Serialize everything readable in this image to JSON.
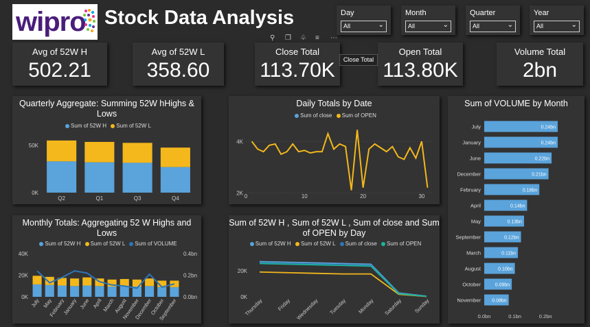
{
  "header": {
    "title": "Stock Data Analysis",
    "logo_text": "wipro"
  },
  "slicers": [
    {
      "label": "Day",
      "value": "All"
    },
    {
      "label": "Month",
      "value": "All"
    },
    {
      "label": "Quarter",
      "value": "All"
    },
    {
      "label": "Year",
      "value": "All"
    }
  ],
  "kpis": [
    {
      "label": "Avg of 52W H",
      "value": "502.21"
    },
    {
      "label": "Avg of 52W L",
      "value": "358.60"
    },
    {
      "label": "Close Total",
      "value": "113.70K"
    },
    {
      "label": "Open Total",
      "value": "113.80K"
    },
    {
      "label": "Volume Total",
      "value": "2bn"
    }
  ],
  "tooltip": "Close Total",
  "colors": {
    "blue": "#5aa3db",
    "yellow": "#f4b81c",
    "darkblue": "#2e75b6",
    "teal": "#1bb39a"
  },
  "chart_data": [
    {
      "type": "bar",
      "title": "Quarterly Aggregate: Summing 52W hHighs & Lows",
      "stacked": true,
      "categories": [
        "Q2",
        "Q1",
        "Q3",
        "Q4"
      ],
      "series": [
        {
          "name": "Sum of 52W H",
          "values": [
            33000,
            32000,
            31500,
            27000
          ]
        },
        {
          "name": "Sum of 52W L",
          "values": [
            22000,
            21500,
            21000,
            20500
          ]
        }
      ],
      "yticks": [
        "0K",
        "50K"
      ],
      "ylim": [
        0,
        60000
      ]
    },
    {
      "type": "line",
      "title": "Daily Totals by Date",
      "x": [
        1,
        2,
        3,
        4,
        5,
        6,
        7,
        8,
        9,
        10,
        11,
        12,
        13,
        14,
        15,
        16,
        17,
        18,
        19,
        20,
        21,
        22,
        23,
        24,
        25,
        26,
        27,
        28,
        29,
        30,
        31
      ],
      "series": [
        {
          "name": "Sum of close",
          "values": []
        },
        {
          "name": "Sum of OPEN",
          "values": [
            4000,
            3700,
            3600,
            3850,
            3900,
            3500,
            3600,
            3900,
            3600,
            3650,
            3550,
            3600,
            3600,
            4300,
            3700,
            3900,
            3800,
            2100,
            4450,
            2200,
            3700,
            3900,
            3750,
            3600,
            3800,
            3400,
            3300,
            3750,
            3350,
            4000,
            2200
          ]
        }
      ],
      "xticks": [
        "0",
        "10",
        "20",
        "30"
      ],
      "yticks": [
        "2K",
        "4K"
      ],
      "xlim": [
        0,
        32
      ],
      "ylim": [
        1900,
        4700
      ]
    },
    {
      "type": "bar",
      "orientation": "horizontal",
      "title": "Sum of VOLUME by Month",
      "categories": [
        "July",
        "January",
        "June",
        "December",
        "February",
        "April",
        "May",
        "September",
        "March",
        "August",
        "October",
        "November"
      ],
      "values": [
        0.24,
        0.24,
        0.22,
        0.21,
        0.18,
        0.14,
        0.13,
        0.12,
        0.11,
        0.1,
        0.09,
        0.08
      ],
      "labels": [
        "0.24bn",
        "0.24bn",
        "0.22bn",
        "0.21bn",
        "0.18bn",
        "0.14bn",
        "0.13bn",
        "0.12bn",
        "0.11bn",
        "0.10bn",
        "0.09bn",
        "0.08bn"
      ],
      "xticks": [
        "0.0bn",
        "0.1bn",
        "0.2bn"
      ],
      "xlim": [
        0,
        0.24
      ]
    },
    {
      "type": "bar",
      "title": "Monthly Totals: Aggregating 52 W Highs and Lows",
      "stacked": true,
      "categories": [
        "July",
        "May",
        "February",
        "January",
        "June",
        "April",
        "March",
        "August",
        "November",
        "December",
        "October",
        "September"
      ],
      "series": [
        {
          "name": "Sum of 52W H",
          "values": [
            11500,
            11000,
            10500,
            10000,
            10500,
            10000,
            9500,
            10000,
            9500,
            10000,
            9000,
            9000
          ]
        },
        {
          "name": "Sum of 52W L",
          "values": [
            8000,
            7500,
            7000,
            7000,
            7500,
            7000,
            6500,
            6500,
            6500,
            7000,
            6000,
            6000
          ]
        },
        {
          "name": "Sum of VOLUME",
          "values": [
            0.24,
            0.13,
            0.18,
            0.24,
            0.22,
            0.14,
            0.11,
            0.1,
            0.08,
            0.21,
            0.09,
            0.12
          ]
        }
      ],
      "yticks": [
        "0K",
        "20K",
        "40K"
      ],
      "y2ticks": [
        "0.0bn",
        "0.2bn",
        "0.4bn"
      ],
      "ylim": [
        0,
        40000
      ],
      "y2lim": [
        0,
        0.4
      ]
    },
    {
      "type": "line",
      "title": "Sum of 52W H , Sum of 52W L , Sum of close and Sum of OPEN by Day",
      "categories": [
        "Thursday",
        "Friday",
        "Wednesday",
        "Tuesday",
        "Monday",
        "Saturday",
        "Sunday"
      ],
      "series": [
        {
          "name": "Sum of 52W H",
          "values": [
            27000,
            26500,
            26000,
            25500,
            25000,
            3000,
            500
          ]
        },
        {
          "name": "Sum of 52W L",
          "values": [
            19000,
            18500,
            18000,
            17500,
            17500,
            2000,
            300
          ]
        },
        {
          "name": "Sum of close",
          "values": [
            26000,
            25500,
            25000,
            24500,
            24000,
            2500,
            400
          ]
        },
        {
          "name": "Sum of OPEN",
          "values": [
            25500,
            25000,
            24500,
            24000,
            23500,
            2400,
            400
          ]
        }
      ],
      "yticks": [
        "0K",
        "20K"
      ],
      "ylim": [
        0,
        32000
      ]
    }
  ]
}
